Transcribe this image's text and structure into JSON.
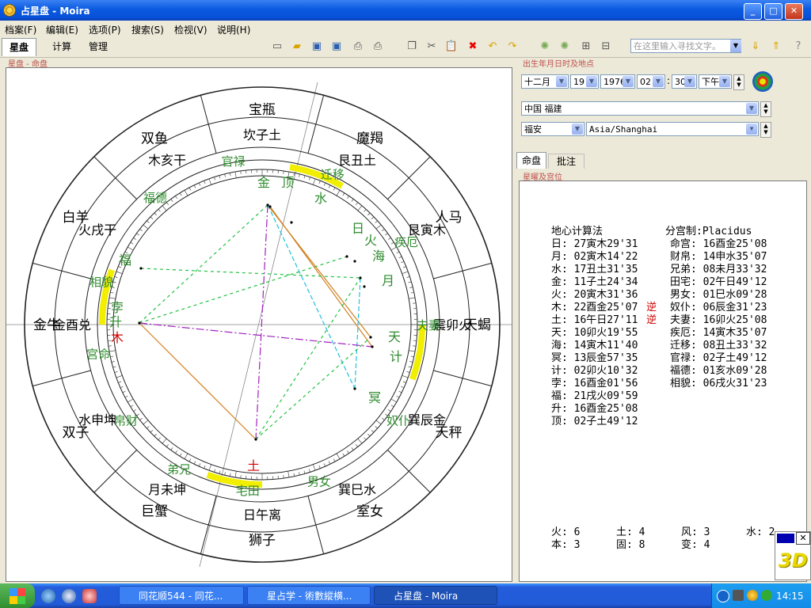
{
  "window": {
    "title": "占星盘 - Moira"
  },
  "titlebar_buttons": {
    "minimize": "_",
    "maximize": "□",
    "close": "✕"
  },
  "menu": [
    "档案(F)",
    "编辑(E)",
    "选项(P)",
    "搜索(S)",
    "检视(V)",
    "说明(H)"
  ],
  "top_tabs": [
    "星盘",
    "计算",
    "管理"
  ],
  "toolbar": {
    "search_placeholder": "在这里输入寻找文字。"
  },
  "labels": {
    "chart_section": "星盘 - 命盘",
    "birth_section": "出生年月日时及地点",
    "info_section": "星曜及宫位"
  },
  "birth": {
    "month": "十二月",
    "day": "19",
    "year": "1976",
    "hour": "02",
    "minute": "30",
    "ampm": "下午",
    "country_province": "中国  福建",
    "city": "福安",
    "timezone": "Asia/Shanghai"
  },
  "info_tabs": [
    "命盘",
    "批注"
  ],
  "info": {
    "method": "地心计算法",
    "house_system": "分宫制:Placidus",
    "planets": [
      "日: 27寅木29'31",
      "月: 02寅木14'22",
      "水: 17丑土31'35",
      "金: 11子土24'34",
      "火: 20寅木31'36",
      "木: 22酉金25'07",
      "土: 16午日27'11",
      "天: 10卯火19'55",
      "海: 14寅木11'40",
      "冥: 13辰金57'35",
      "计: 02卯火10'32",
      "孛: 16酉金01'56",
      "福: 21戌火09'59",
      "升: 16酉金25'08",
      "顶: 02子土49'12"
    ],
    "retro": [
      "逆",
      "逆"
    ],
    "houses": [
      "命宫: 16酉金25'08",
      "财帛: 14申水35'07",
      "兄弟: 08未月33'32",
      "田宅: 02午日49'12",
      "男女: 01巳水09'28",
      "奴仆: 06辰金31'23",
      "夫妻: 16卯火25'08",
      "疾厄: 14寅木35'07",
      "迁移: 08丑土33'32",
      "官禄: 02子土49'12",
      "福德: 01亥水09'28",
      "相貌: 06戌火31'23"
    ],
    "elements": [
      {
        "name": "火",
        "value": "6"
      },
      {
        "name": "土",
        "value": "4"
      },
      {
        "name": "风",
        "value": "3"
      },
      {
        "name": "水",
        "value": "2"
      }
    ],
    "modes": [
      {
        "name": "本",
        "value": "3"
      },
      {
        "name": "固",
        "value": "8"
      },
      {
        "name": "变",
        "value": "4"
      }
    ]
  },
  "chart": {
    "zodiac": [
      "宝瓶",
      "魔羯",
      "人马",
      "天蝎",
      "天秤",
      "室女",
      "狮子",
      "巨蟹",
      "双子",
      "金牛",
      "白羊",
      "双鱼"
    ],
    "palaces": [
      "官禄",
      "迁移",
      "疾厄",
      "夫妻",
      "奴仆",
      "男女",
      "宅田",
      "弟兄",
      "帛财",
      "宫命",
      "相貌",
      "福德"
    ],
    "branches": [
      "坎子土",
      "艮丑土",
      "艮寅木",
      "震卯火",
      "巽辰金",
      "巽巳水",
      "日午离",
      "月未坤",
      "水申坤",
      "金酉兑",
      "火戌干",
      "木亥干"
    ],
    "planets_on_chart": [
      "金",
      "顶",
      "水",
      "日",
      "火",
      "海",
      "月",
      "天",
      "计",
      "冥",
      "土",
      "孛",
      "升",
      "木",
      "福"
    ]
  },
  "colors": {
    "green": "#2e8b2e",
    "red": "#d00000",
    "yellow_band": "#f2ee00"
  },
  "taskbar": {
    "tasks": [
      "同花顺544 - 同花...",
      "星占学 - 術數縱横...",
      "占星盘 - Moira"
    ],
    "clock": "14:15"
  },
  "logo": "3D"
}
